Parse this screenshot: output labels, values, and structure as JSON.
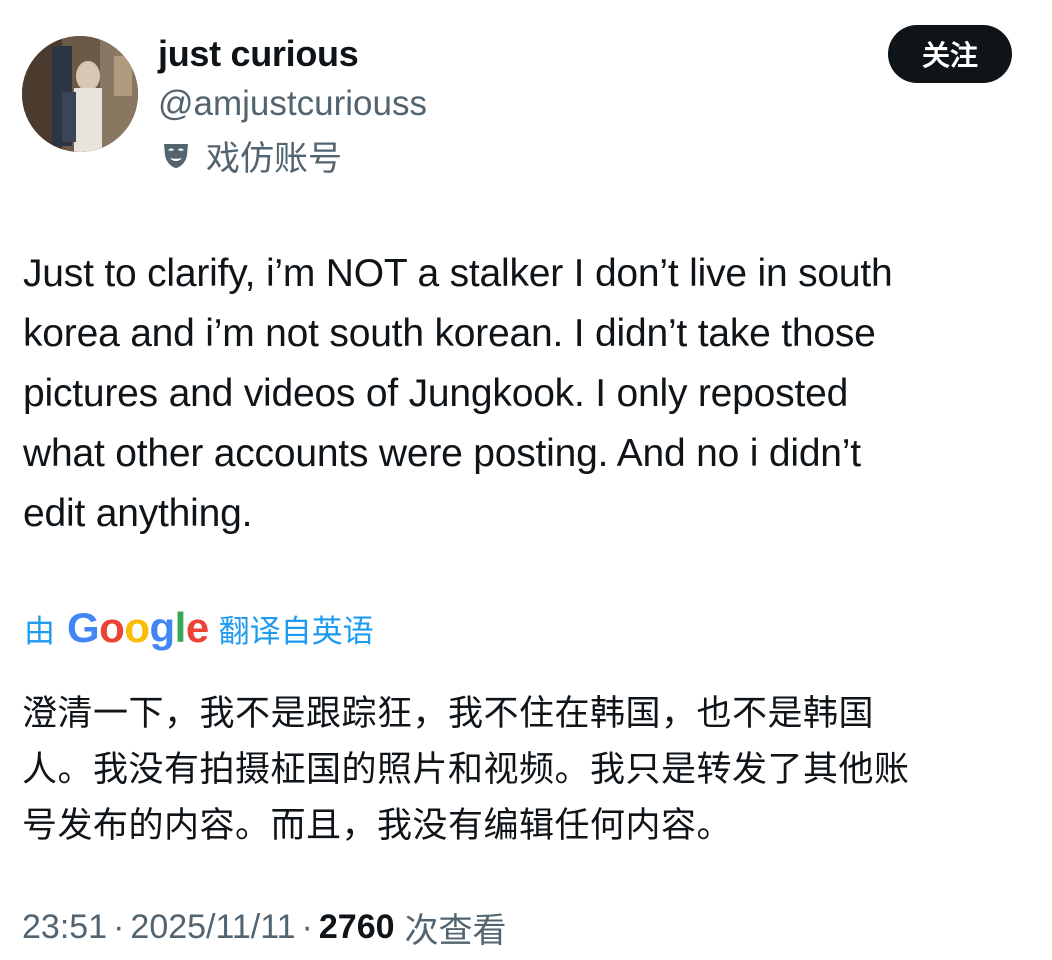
{
  "author": {
    "display_name": "just curious",
    "handle": "@amjustcuriouss",
    "account_label": "戏仿账号",
    "account_label_icon": "parody-mask-icon"
  },
  "follow_button": {
    "label": "关注"
  },
  "tweet": {
    "text": "Just to clarify, i’m NOT a stalker I don’t live in south\nkorea and i’m not south korean. I didn’t take those\npictures and videos of Jungkook. I only reposted\nwhat other accounts were posting. And no i didn’t\nedit anything."
  },
  "translation": {
    "by_label": "由",
    "provider": "Google",
    "from_label": "翻译自英语",
    "text": "澄清一下，我不是跟踪狂，我不住在韩国，也不是韩国\n人。我没有拍摄柾国的照片和视频。我只是转发了其他账\n号发布的内容。而且，我没有编辑任何内容。"
  },
  "meta": {
    "time": "23:51",
    "separator": "·",
    "date": "2025/11/11",
    "views_count": "2760",
    "views_label": "次查看"
  },
  "colors": {
    "text_primary": "#0f1419",
    "text_secondary": "#536471",
    "link_blue": "#1d9bf0",
    "follow_bg": "#0f1419"
  }
}
